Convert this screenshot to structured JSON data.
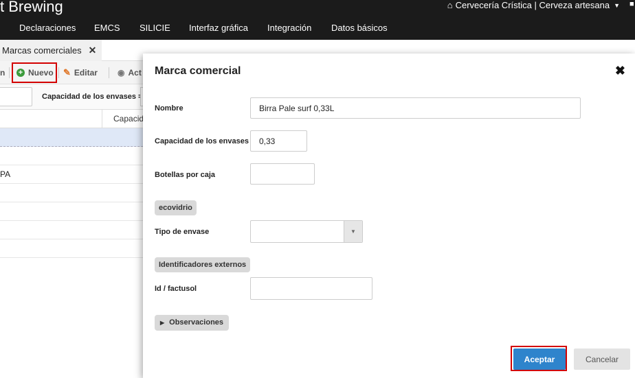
{
  "brand": "t Brewing",
  "account": {
    "label": "Cervecería Crística | Cerveza artesana"
  },
  "nav": [
    "Declaraciones",
    "EMCS",
    "SILICIE",
    "Interfaz gráfica",
    "Integración",
    "Datos básicos"
  ],
  "tab": {
    "label": "Marcas comerciales"
  },
  "toolbar": {
    "prev_label": "n",
    "new_label": "Nuevo",
    "edit_label": "Editar",
    "act_label": "Act"
  },
  "filter": {
    "capacity_label": "Capacidad de los envases ="
  },
  "grid": {
    "capacity_header": "Capacid",
    "row_text": "PA"
  },
  "dialog": {
    "title": "Marca comercial",
    "name_label": "Nombre",
    "name_value": "Birra Pale surf 0,33L",
    "capacity_label": "Capacidad de los envases",
    "capacity_value": "0,33",
    "bottles_label": "Botellas por caja",
    "bottles_value": "",
    "section_ecovidrio": "ecovidrio",
    "container_type_label": "Tipo de envase",
    "container_type_value": "",
    "section_external": "Identificadores externos",
    "factusol_label": "Id / factusol",
    "factusol_value": "",
    "observations_label": "Observaciones",
    "accept_label": "Aceptar",
    "cancel_label": "Cancelar"
  },
  "colors": {
    "topbar": "#1b1b1b",
    "accept": "#2e84cc",
    "highlight": "#d30000",
    "new_icon": "#3c9b3c",
    "edit_icon": "#e07a2e"
  }
}
